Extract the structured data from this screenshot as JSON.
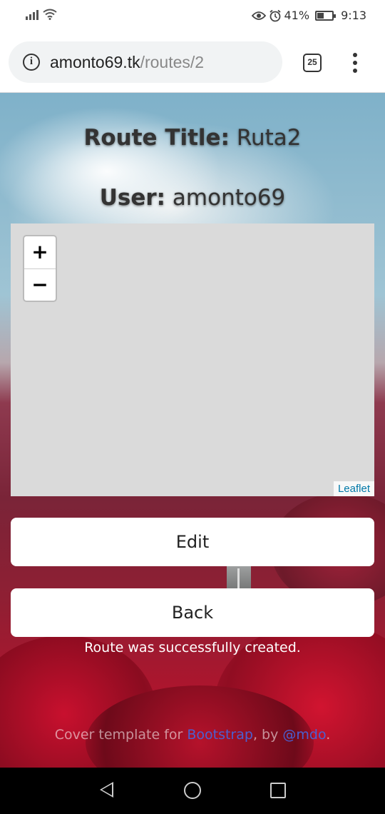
{
  "status_bar": {
    "battery": "41%",
    "battery_level": 0.41,
    "time": "9:13"
  },
  "browser": {
    "url_domain": "amonto69.tk",
    "url_path": "/routes/2",
    "tab_count": "25"
  },
  "page": {
    "route_title_label": "Route Title:",
    "route_title_value": "Ruta2",
    "user_label": "User:",
    "user_value": "amonto69",
    "map": {
      "zoom_in": "+",
      "zoom_out": "−",
      "attribution": "Leaflet"
    },
    "edit_button": "Edit",
    "back_button": "Back",
    "flash_message": "Route was successfully created.",
    "footer": {
      "prefix": "Cover template for ",
      "bootstrap_link": "Bootstrap",
      "middle": ", by ",
      "author_link": "@mdo",
      "suffix": "."
    }
  },
  "colors": {
    "link": "#4b5fd1",
    "leaflet_link": "#0078a8",
    "map_background": "#dadada"
  },
  "icons": [
    "signal-icon",
    "wifi-icon",
    "eye-icon",
    "alarm-icon",
    "battery-icon",
    "info-icon",
    "tabs-icon",
    "overflow-menu-icon",
    "nav-back-icon",
    "nav-home-icon",
    "nav-recent-icon"
  ]
}
